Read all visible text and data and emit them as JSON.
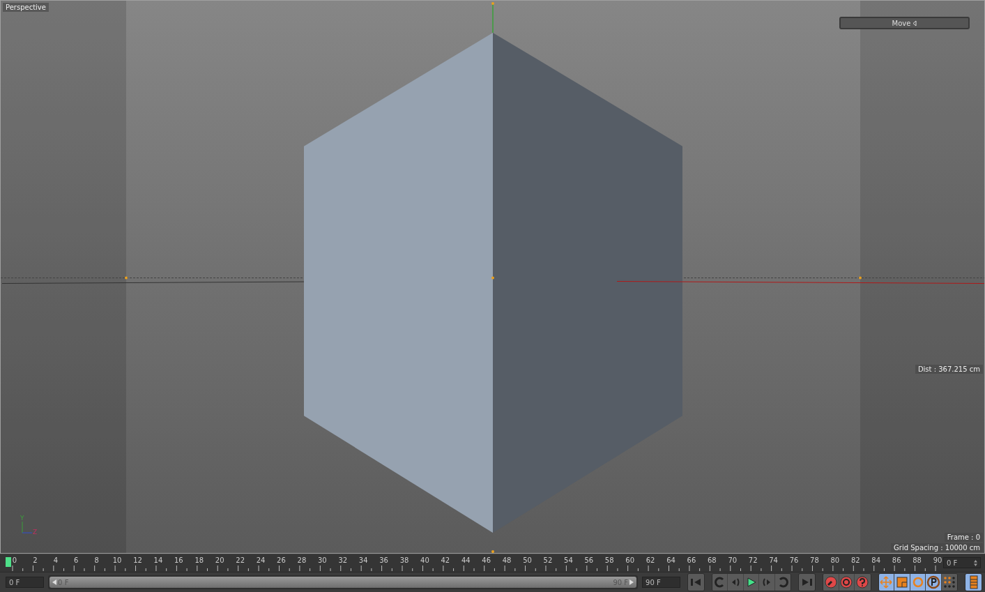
{
  "viewport": {
    "title": "Perspective",
    "hud_button": "Move",
    "distance": "Dist : 367.215 cm",
    "frame": "Frame : 0",
    "grid_spacing": "Grid Spacing : 10000 cm",
    "axis_labels": [
      "Y",
      "Z"
    ]
  },
  "timeline": {
    "ruler_labels": [
      "0",
      "2",
      "4",
      "6",
      "8",
      "10",
      "12",
      "14",
      "16",
      "18",
      "20",
      "22",
      "24",
      "26",
      "28",
      "30",
      "32",
      "34",
      "36",
      "38",
      "40",
      "42",
      "44",
      "46",
      "48",
      "50",
      "52",
      "54",
      "56",
      "58",
      "60",
      "62",
      "64",
      "66",
      "68",
      "70",
      "72",
      "74",
      "76",
      "78",
      "80",
      "82",
      "84",
      "86",
      "88",
      "90"
    ],
    "playhead": {
      "level": 0
    },
    "current_frame": "0 F"
  },
  "controls": {
    "start_field": "0 F",
    "range_start": "0 F",
    "range_end": "90 F",
    "range_slider": {
      "level": 1
    },
    "end_field": "90 F",
    "transport": [
      {
        "kind": "first"
      },
      {
        "kind": "prev-key"
      },
      {
        "kind": "prev-frame"
      },
      {
        "kind": "play"
      },
      {
        "kind": "next-frame"
      },
      {
        "kind": "next-key"
      },
      {
        "kind": "last"
      }
    ],
    "record": [
      {
        "kind": "record"
      },
      {
        "kind": "autokey"
      },
      {
        "kind": "keyselection"
      }
    ],
    "modes": [
      {
        "kind": "move",
        "selected": true
      },
      {
        "kind": "scale",
        "selected": true
      },
      {
        "kind": "rotate",
        "selected": true
      },
      {
        "kind": "param",
        "selected": true
      },
      {
        "kind": "points",
        "selected": false
      }
    ],
    "timeline_toggle": {
      "selected": true
    }
  }
}
